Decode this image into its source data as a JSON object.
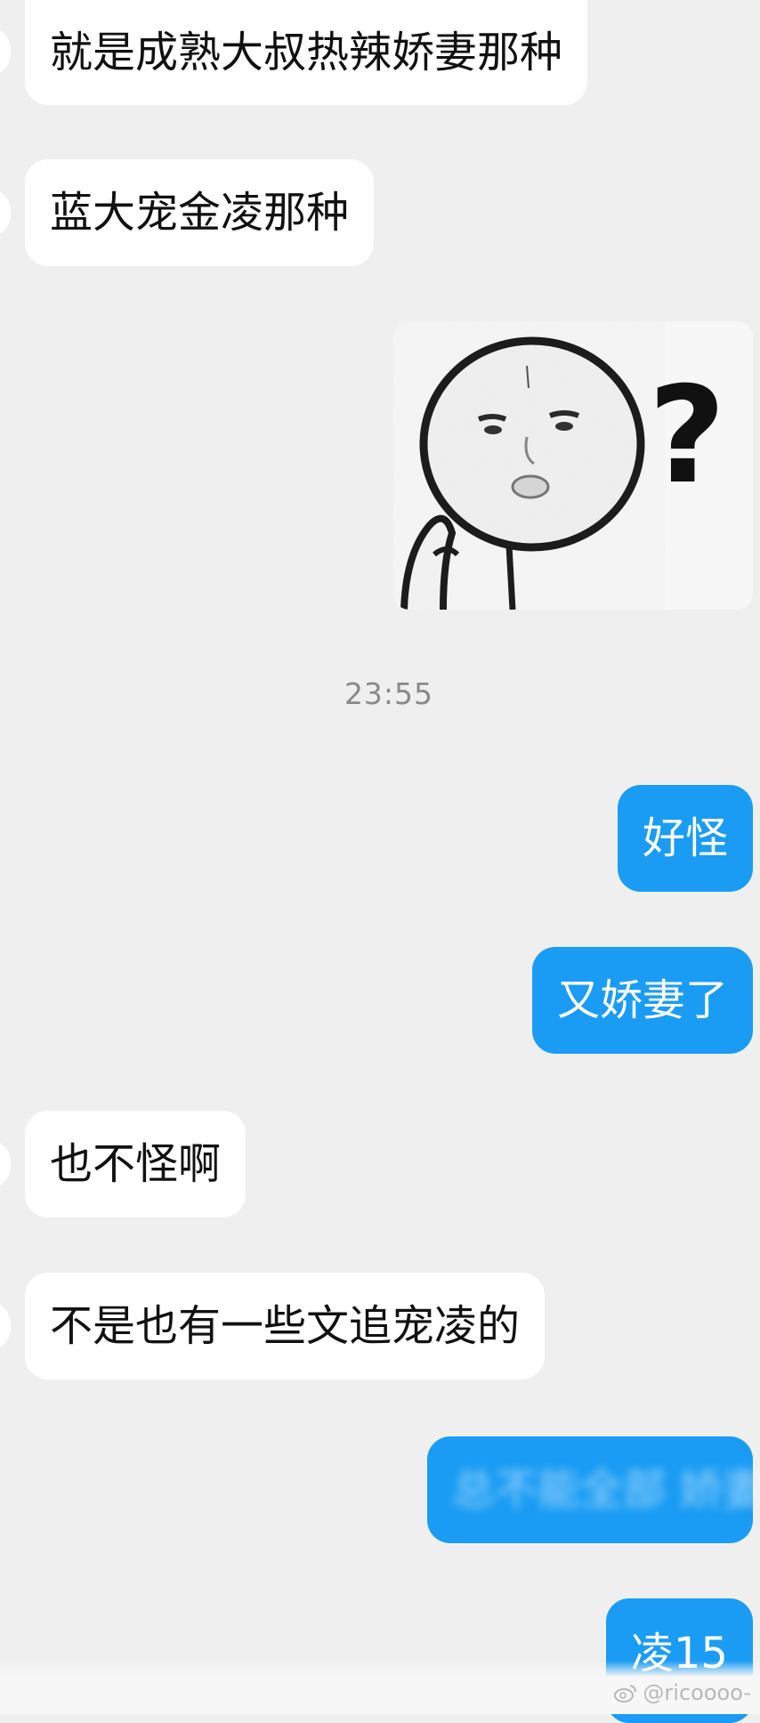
{
  "messages": [
    {
      "text": "就是成熟大叔热辣娇妻那种"
    },
    {
      "text": "蓝大宠金凌那种"
    },
    {
      "text": "好怪"
    },
    {
      "text": "又娇妻了"
    },
    {
      "text": "也不怪啊"
    },
    {
      "text": "不是也有一些文追宠凌的"
    },
    {
      "text": "总不能全部 娇妻"
    },
    {
      "text": "凌15"
    }
  ],
  "timestamp": "23:55",
  "watermark": "@ricoooo-",
  "colors": {
    "background": "#efefef",
    "incoming_bubble": "#ffffff",
    "outgoing_bubble": "#1a9cf4"
  },
  "sticker": {
    "icon": "confused-face-sticker",
    "glyph": "?"
  }
}
